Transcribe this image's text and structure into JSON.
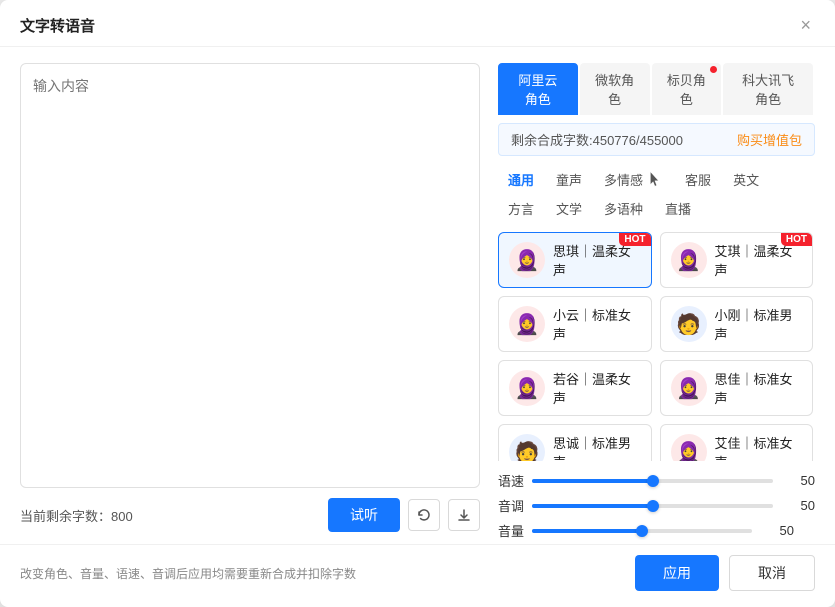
{
  "dialog": {
    "title": "文字转语音",
    "close_label": "×"
  },
  "left": {
    "textarea_placeholder": "输入内容",
    "remaining_label": "当前剩余字数：",
    "remaining_count": "800",
    "btn_preview": "试听",
    "btn_restore_icon": "↺",
    "btn_download_icon": "↓"
  },
  "right": {
    "tabs": [
      {
        "id": "aliyun",
        "label": "阿里云角色",
        "active": true,
        "badge": false
      },
      {
        "id": "microsoft",
        "label": "微软角色",
        "active": false,
        "badge": false
      },
      {
        "id": "biaobeiyun",
        "label": "标贝角色",
        "active": false,
        "badge": true
      },
      {
        "id": "xunfei",
        "label": "科大讯飞角色",
        "active": false,
        "badge": false
      }
    ],
    "quota": {
      "label": "剩余合成字数:450776/455000",
      "link": "购买增值包"
    },
    "sub_tabs": [
      {
        "id": "general",
        "label": "通用",
        "active": true
      },
      {
        "id": "child",
        "label": "童声",
        "active": false
      },
      {
        "id": "emotion",
        "label": "多情感",
        "active": false
      },
      {
        "id": "customer",
        "label": "客服",
        "active": false
      },
      {
        "id": "english",
        "label": "英文",
        "active": false
      },
      {
        "id": "dialect",
        "label": "方言",
        "active": false
      },
      {
        "id": "literary",
        "label": "文学",
        "active": false
      },
      {
        "id": "multilang",
        "label": "多语种",
        "active": false
      },
      {
        "id": "live",
        "label": "直播",
        "active": false
      }
    ],
    "voices": [
      {
        "id": "siqin",
        "name": "思琪｜温柔女声",
        "avatar": "👩",
        "hot": true,
        "selected": true,
        "avatar_bg": "female"
      },
      {
        "id": "aizhen",
        "name": "艾琪｜温柔女声",
        "avatar": "👩",
        "hot": true,
        "selected": false,
        "avatar_bg": "female"
      },
      {
        "id": "xiaoyun",
        "name": "小云｜标准女声",
        "avatar": "👩",
        "hot": false,
        "selected": false,
        "avatar_bg": "female"
      },
      {
        "id": "xiaogang",
        "name": "小刚｜标准男声",
        "avatar": "🧑",
        "hot": false,
        "selected": false,
        "avatar_bg": "male"
      },
      {
        "id": "ruogu",
        "name": "若谷｜温柔女声",
        "avatar": "👩",
        "hot": false,
        "selected": false,
        "avatar_bg": "female"
      },
      {
        "id": "sijia",
        "name": "思佳｜标准女声",
        "avatar": "👩",
        "hot": false,
        "selected": false,
        "avatar_bg": "female"
      },
      {
        "id": "sicheng",
        "name": "思诚｜标准男声",
        "avatar": "🧑",
        "hot": false,
        "selected": false,
        "avatar_bg": "male"
      },
      {
        "id": "aijia",
        "name": "艾佳｜标准女声",
        "avatar": "👩",
        "hot": false,
        "selected": false,
        "avatar_bg": "female"
      }
    ],
    "sliders": {
      "speed": {
        "label": "语速",
        "value": 50.0,
        "percent": 50
      },
      "pitch": {
        "label": "音调",
        "value": 50.0,
        "percent": 50
      },
      "volume": {
        "label": "音量",
        "value": 50.0,
        "percent": 50
      }
    }
  },
  "footer": {
    "hint": "改变角色、音量、语速、音调后应用均需要重新合成并扣除字数",
    "btn_apply": "应用",
    "btn_cancel": "取消"
  }
}
